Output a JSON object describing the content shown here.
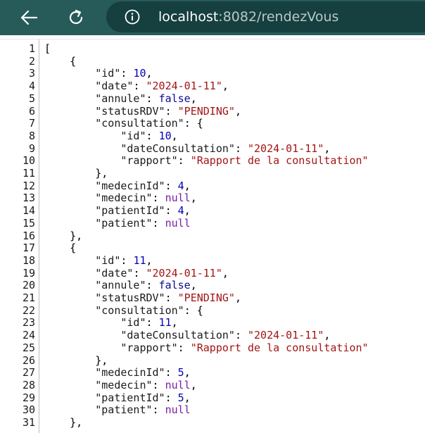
{
  "browser": {
    "url_host": "localhost",
    "url_path": ":8082/rendezVous",
    "icons": {
      "back": "back-arrow-icon",
      "refresh": "refresh-icon",
      "info": "info-icon"
    }
  },
  "json_view": {
    "lines": [
      {
        "n": "1",
        "parts": [
          {
            "t": "[",
            "c": "p"
          }
        ]
      },
      {
        "n": "2",
        "parts": [
          {
            "t": "    {",
            "c": "p"
          }
        ]
      },
      {
        "n": "3",
        "parts": [
          {
            "t": "        \"id\"",
            "c": "k"
          },
          {
            "t": ": ",
            "c": "p"
          },
          {
            "t": "10",
            "c": "n"
          },
          {
            "t": ",",
            "c": "p"
          }
        ]
      },
      {
        "n": "4",
        "parts": [
          {
            "t": "        \"date\"",
            "c": "k"
          },
          {
            "t": ": ",
            "c": "p"
          },
          {
            "t": "\"2024-01-11\"",
            "c": "s"
          },
          {
            "t": ",",
            "c": "p"
          }
        ]
      },
      {
        "n": "5",
        "parts": [
          {
            "t": "        \"annule\"",
            "c": "k"
          },
          {
            "t": ": ",
            "c": "p"
          },
          {
            "t": "false",
            "c": "b"
          },
          {
            "t": ",",
            "c": "p"
          }
        ]
      },
      {
        "n": "6",
        "parts": [
          {
            "t": "        \"statusRDV\"",
            "c": "k"
          },
          {
            "t": ": ",
            "c": "p"
          },
          {
            "t": "\"PENDING\"",
            "c": "s"
          },
          {
            "t": ",",
            "c": "p"
          }
        ]
      },
      {
        "n": "7",
        "parts": [
          {
            "t": "        \"consultation\"",
            "c": "k"
          },
          {
            "t": ": {",
            "c": "p"
          }
        ]
      },
      {
        "n": "8",
        "parts": [
          {
            "t": "            \"id\"",
            "c": "k"
          },
          {
            "t": ": ",
            "c": "p"
          },
          {
            "t": "10",
            "c": "n"
          },
          {
            "t": ",",
            "c": "p"
          }
        ]
      },
      {
        "n": "9",
        "parts": [
          {
            "t": "            \"dateConsultation\"",
            "c": "k"
          },
          {
            "t": ": ",
            "c": "p"
          },
          {
            "t": "\"2024-01-11\"",
            "c": "s"
          },
          {
            "t": ",",
            "c": "p"
          }
        ]
      },
      {
        "n": "10",
        "parts": [
          {
            "t": "            \"rapport\"",
            "c": "k"
          },
          {
            "t": ": ",
            "c": "p"
          },
          {
            "t": "\"Rapport de la consultation\"",
            "c": "s"
          }
        ]
      },
      {
        "n": "11",
        "parts": [
          {
            "t": "        },",
            "c": "p"
          }
        ]
      },
      {
        "n": "12",
        "parts": [
          {
            "t": "        \"medecinId\"",
            "c": "k"
          },
          {
            "t": ": ",
            "c": "p"
          },
          {
            "t": "4",
            "c": "n"
          },
          {
            "t": ",",
            "c": "p"
          }
        ]
      },
      {
        "n": "13",
        "parts": [
          {
            "t": "        \"medecin\"",
            "c": "k"
          },
          {
            "t": ": ",
            "c": "p"
          },
          {
            "t": "null",
            "c": "nl"
          },
          {
            "t": ",",
            "c": "p"
          }
        ]
      },
      {
        "n": "14",
        "parts": [
          {
            "t": "        \"patientId\"",
            "c": "k"
          },
          {
            "t": ": ",
            "c": "p"
          },
          {
            "t": "4",
            "c": "n"
          },
          {
            "t": ",",
            "c": "p"
          }
        ]
      },
      {
        "n": "15",
        "parts": [
          {
            "t": "        \"patient\"",
            "c": "k"
          },
          {
            "t": ": ",
            "c": "p"
          },
          {
            "t": "null",
            "c": "nl"
          }
        ]
      },
      {
        "n": "16",
        "parts": [
          {
            "t": "    },",
            "c": "p"
          }
        ]
      },
      {
        "n": "17",
        "parts": [
          {
            "t": "    {",
            "c": "p"
          }
        ]
      },
      {
        "n": "18",
        "parts": [
          {
            "t": "        \"id\"",
            "c": "k"
          },
          {
            "t": ": ",
            "c": "p"
          },
          {
            "t": "11",
            "c": "n"
          },
          {
            "t": ",",
            "c": "p"
          }
        ]
      },
      {
        "n": "19",
        "parts": [
          {
            "t": "        \"date\"",
            "c": "k"
          },
          {
            "t": ": ",
            "c": "p"
          },
          {
            "t": "\"2024-01-11\"",
            "c": "s"
          },
          {
            "t": ",",
            "c": "p"
          }
        ]
      },
      {
        "n": "20",
        "parts": [
          {
            "t": "        \"annule\"",
            "c": "k"
          },
          {
            "t": ": ",
            "c": "p"
          },
          {
            "t": "false",
            "c": "b"
          },
          {
            "t": ",",
            "c": "p"
          }
        ]
      },
      {
        "n": "21",
        "parts": [
          {
            "t": "        \"statusRDV\"",
            "c": "k"
          },
          {
            "t": ": ",
            "c": "p"
          },
          {
            "t": "\"PENDING\"",
            "c": "s"
          },
          {
            "t": ",",
            "c": "p"
          }
        ]
      },
      {
        "n": "22",
        "parts": [
          {
            "t": "        \"consultation\"",
            "c": "k"
          },
          {
            "t": ": {",
            "c": "p"
          }
        ]
      },
      {
        "n": "23",
        "parts": [
          {
            "t": "            \"id\"",
            "c": "k"
          },
          {
            "t": ": ",
            "c": "p"
          },
          {
            "t": "11",
            "c": "n"
          },
          {
            "t": ",",
            "c": "p"
          }
        ]
      },
      {
        "n": "24",
        "parts": [
          {
            "t": "            \"dateConsultation\"",
            "c": "k"
          },
          {
            "t": ": ",
            "c": "p"
          },
          {
            "t": "\"2024-01-11\"",
            "c": "s"
          },
          {
            "t": ",",
            "c": "p"
          }
        ]
      },
      {
        "n": "25",
        "parts": [
          {
            "t": "            \"rapport\"",
            "c": "k"
          },
          {
            "t": ": ",
            "c": "p"
          },
          {
            "t": "\"Rapport de la consultation\"",
            "c": "s"
          }
        ]
      },
      {
        "n": "26",
        "parts": [
          {
            "t": "        },",
            "c": "p"
          }
        ]
      },
      {
        "n": "27",
        "parts": [
          {
            "t": "        \"medecinId\"",
            "c": "k"
          },
          {
            "t": ": ",
            "c": "p"
          },
          {
            "t": "5",
            "c": "n"
          },
          {
            "t": ",",
            "c": "p"
          }
        ]
      },
      {
        "n": "28",
        "parts": [
          {
            "t": "        \"medecin\"",
            "c": "k"
          },
          {
            "t": ": ",
            "c": "p"
          },
          {
            "t": "null",
            "c": "nl"
          },
          {
            "t": ",",
            "c": "p"
          }
        ]
      },
      {
        "n": "29",
        "parts": [
          {
            "t": "        \"patientId\"",
            "c": "k"
          },
          {
            "t": ": ",
            "c": "p"
          },
          {
            "t": "5",
            "c": "n"
          },
          {
            "t": ",",
            "c": "p"
          }
        ]
      },
      {
        "n": "30",
        "parts": [
          {
            "t": "        \"patient\"",
            "c": "k"
          },
          {
            "t": ": ",
            "c": "p"
          },
          {
            "t": "null",
            "c": "nl"
          }
        ]
      },
      {
        "n": "31",
        "parts": [
          {
            "t": "    },",
            "c": "p"
          }
        ]
      }
    ]
  }
}
